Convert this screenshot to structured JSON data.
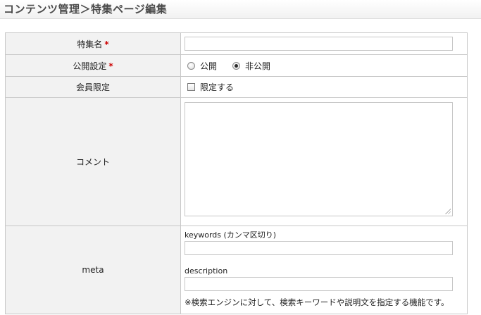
{
  "header": {
    "title": "コンテンツ管理＞特集ページ編集"
  },
  "form": {
    "name": {
      "label": "特集名",
      "required_mark": "*",
      "value": ""
    },
    "publish": {
      "label": "公開設定",
      "required_mark": "*",
      "options": [
        "公開",
        "非公開"
      ],
      "selected": "非公開"
    },
    "member_only": {
      "label": "会員限定",
      "checkbox_label": "限定する",
      "checked": false
    },
    "comment": {
      "label": "コメント",
      "value": ""
    },
    "meta": {
      "label": "meta",
      "keywords_label": "keywords (カンマ区切り)",
      "keywords_value": "",
      "description_label": "description",
      "description_value": "",
      "note": "※検索エンジンに対して、検索キーワードや説明文を指定する機能です。"
    }
  },
  "colors": {
    "required": "#cc0000",
    "label_bg": "#f2f2f2",
    "border": "#c8c8c8"
  }
}
